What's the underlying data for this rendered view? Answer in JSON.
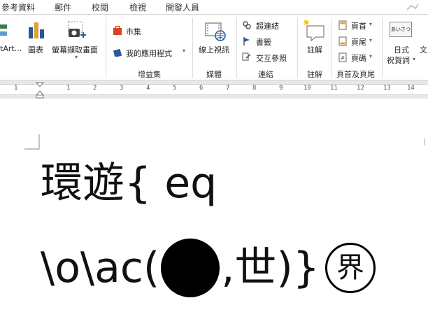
{
  "tabs": [
    "參考資料",
    "郵件",
    "校閱",
    "檢視",
    "開發人員"
  ],
  "ribbon": {
    "smartart_label": "tArt...",
    "chart_label": "圖表",
    "screenshot_label": "螢幕擷取畫面",
    "store_label": "市集",
    "my_apps_label": "我的應用程式",
    "addins_group": "增益集",
    "online_video_label": "線上視訊",
    "media_group": "媒體",
    "hyperlink_label": "超連結",
    "bookmark_label": "書籤",
    "crossref_label": "交互參照",
    "links_group": "連結",
    "comment_label": "註解",
    "comments_group": "註解",
    "header_label": "頁首",
    "footer_label": "頁尾",
    "pagenum_label": "頁碼",
    "header_footer_group": "頁首及頁尾",
    "greeting_label1": "日式",
    "greeting_label2": "祝賀詞",
    "greeting_icon_text": "あいさつ",
    "text_label": "文"
  },
  "ruler": {
    "numbers": [
      "1",
      "1",
      "2",
      "3",
      "4",
      "5",
      "6",
      "7",
      "8",
      "9",
      "10",
      "11",
      "12",
      "13",
      "14"
    ]
  },
  "document": {
    "line1": "環遊{ eq",
    "line2_a": "\\o\\ac(",
    "line2_b": ",世)}",
    "enclosed_char": "界"
  },
  "colors": {
    "accent_red": "#d24726",
    "accent_blue": "#2b579a",
    "text": "#111111"
  }
}
